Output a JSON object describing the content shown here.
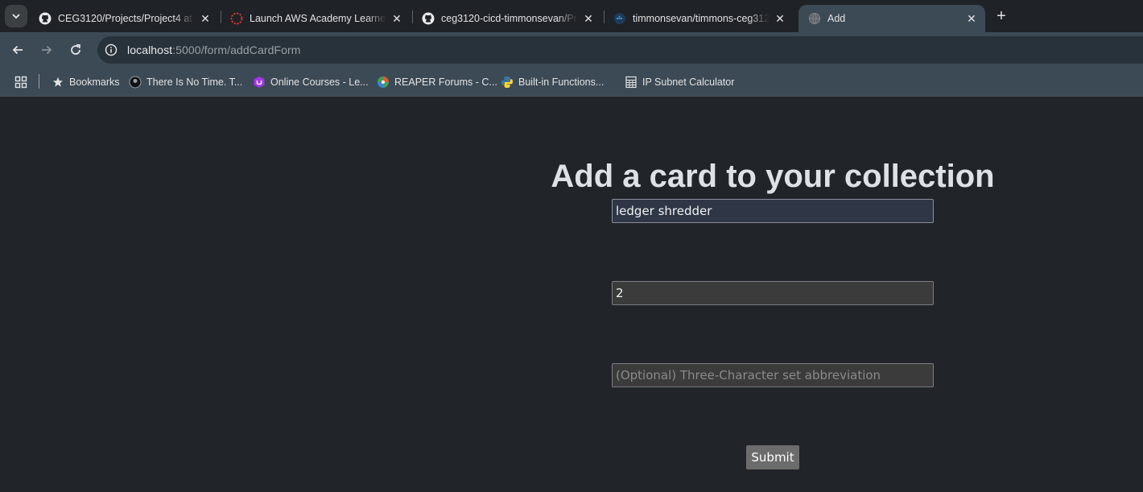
{
  "browser": {
    "tabs": [
      {
        "title": "CEG3120/Projects/Project4 at m",
        "icon": "github-icon"
      },
      {
        "title": "Launch AWS Academy Learner L",
        "icon": "aws-academy-icon"
      },
      {
        "title": "ceg3120-cicd-timmonsevan/Pro",
        "icon": "github-icon"
      },
      {
        "title": "timmonsevan/timmons-ceg3120",
        "icon": "docker-icon"
      },
      {
        "title": "Add",
        "icon": "globe-icon"
      }
    ],
    "address_bar": {
      "host": "localhost",
      "path": ":5000/form/addCardForm"
    },
    "bookmarks": [
      {
        "label": "Bookmarks",
        "icon": "star-icon"
      },
      {
        "label": "There Is No Time. T...",
        "icon": "avatar-icon"
      },
      {
        "label": "Online Courses - Le...",
        "icon": "udemy-icon"
      },
      {
        "label": "REAPER Forums - C...",
        "icon": "reaper-icon"
      },
      {
        "label": "Built-in Functions...",
        "icon": "python-icon"
      },
      {
        "label": "IP Subnet Calculator",
        "icon": "calculator-icon"
      }
    ]
  },
  "page": {
    "heading": "Add a card to your collection",
    "fields": {
      "card_name": {
        "value": "ledger shredder"
      },
      "quantity": {
        "value": "2"
      },
      "set": {
        "value": "",
        "placeholder": "(Optional) Three-Character set abbreviation"
      }
    },
    "submit_label": "Submit"
  },
  "colors": {
    "page_bg": "#212529",
    "heading": "#dee2e6",
    "toolbar": "#3c4a55"
  }
}
